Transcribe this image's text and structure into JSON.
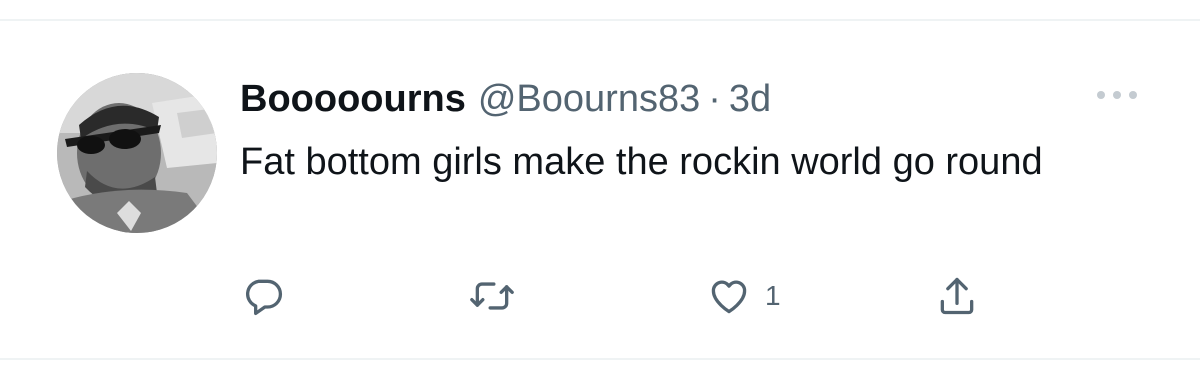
{
  "tweet": {
    "display_name": "Booooourns",
    "handle": "@Boourns83",
    "separator": "·",
    "timestamp": "3d",
    "text": "Fat bottom girls make the rockin world go round",
    "avatar_icon": "user-avatar-photo",
    "more_icon": "more-horizontal-icon"
  },
  "actions": {
    "reply_icon": "reply-icon",
    "retweet_icon": "retweet-icon",
    "like_icon": "heart-icon",
    "like_count": "1",
    "share_icon": "share-icon"
  },
  "colors": {
    "text_primary": "#0f1419",
    "text_secondary": "#536471",
    "divider": "#eff3f4"
  }
}
